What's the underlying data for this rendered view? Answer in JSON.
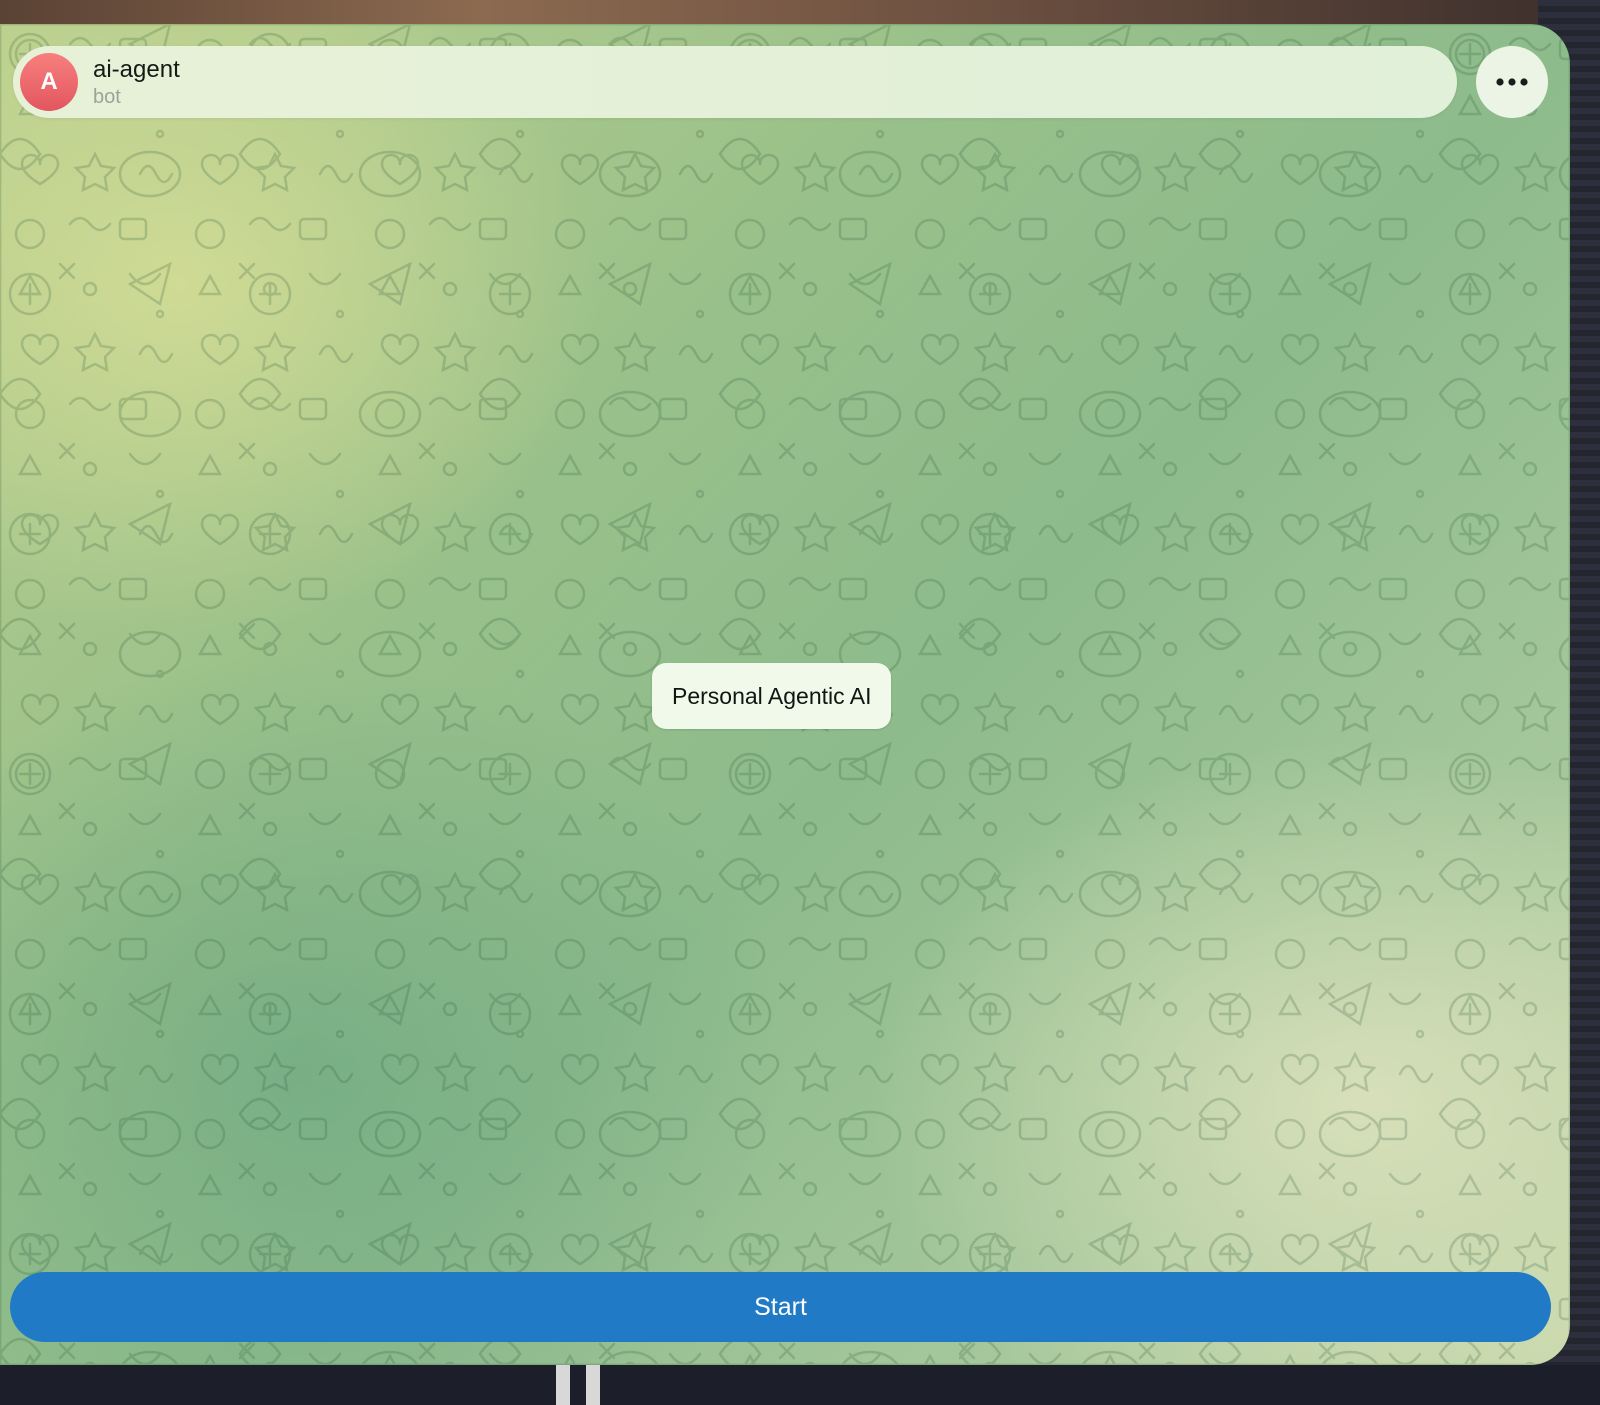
{
  "header": {
    "avatar_letter": "A",
    "bot_name": "ai-agent",
    "bot_status": "bot",
    "more_icon": "more-horizontal-icon"
  },
  "chat": {
    "message_text": "Personal Agentic AI",
    "background_pattern": "doodle-pattern"
  },
  "footer": {
    "start_label": "Start"
  },
  "colors": {
    "accent": "#217ac6",
    "avatar": "#e96a6f",
    "bubble": "#f0f9ea",
    "header": "#e5f1d8"
  }
}
